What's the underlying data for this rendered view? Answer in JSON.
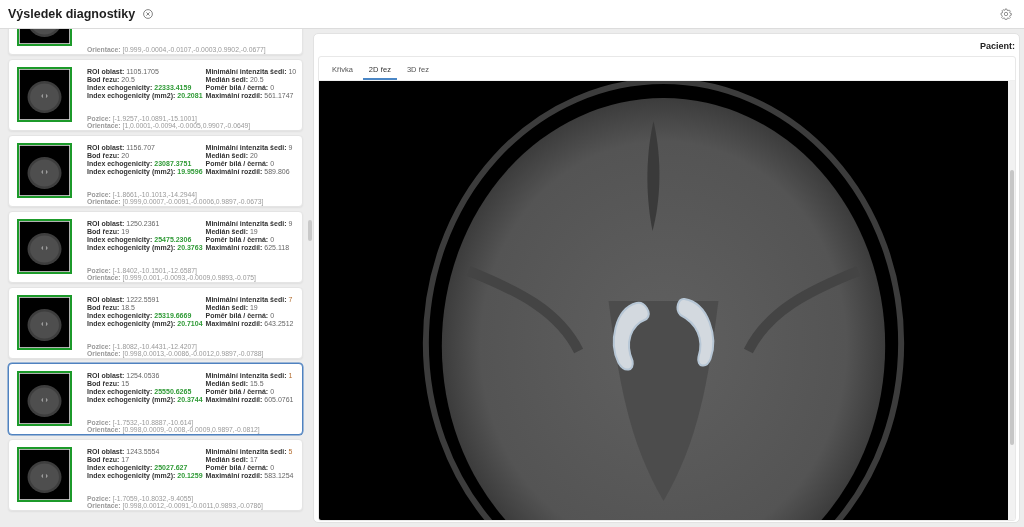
{
  "header": {
    "title": "Výsledek diagnostiky"
  },
  "results": [
    {
      "selected": false,
      "details": [
        {
          "label": "Orientace:",
          "value": "[0.999,-0.0004,-0.0107,-0.0003,0.9902,-0.0677]"
        }
      ]
    },
    {
      "selected": false,
      "left_fields": [
        {
          "label": "ROI oblast:",
          "value": "1105.1705",
          "kind": "plain"
        },
        {
          "label": "Bod řezu:",
          "value": "20.5",
          "kind": "plain"
        },
        {
          "label": "Index echogenicity:",
          "value": "22333.4159",
          "kind": "accent"
        },
        {
          "label": "Index echogenicity (mm2):",
          "value": "20.2081",
          "kind": "accent"
        }
      ],
      "right_fields": [
        {
          "label": "Minimální intenzita šedi:",
          "value": "10",
          "kind": "plain"
        },
        {
          "label": "Medián šedi:",
          "value": "20.5",
          "kind": "plain"
        },
        {
          "label": "Poměr bílá / černá:",
          "value": "0",
          "kind": "plain"
        },
        {
          "label": "Maximální rozdíl:",
          "value": "561.1747",
          "kind": "plain"
        }
      ],
      "details": [
        {
          "label": "Pozice:",
          "value": "[-1.9257,-10.0891,-15.1001]"
        },
        {
          "label": "Orientace:",
          "value": "[1,0.0001,-0.0094,-0.0005,0.9907,-0.0649]"
        }
      ]
    },
    {
      "selected": false,
      "left_fields": [
        {
          "label": "ROI oblast:",
          "value": "1156.707",
          "kind": "plain"
        },
        {
          "label": "Bod řezu:",
          "value": "20",
          "kind": "plain"
        },
        {
          "label": "Index echogenicity:",
          "value": "23087.3751",
          "kind": "accent"
        },
        {
          "label": "Index echogenicity (mm2):",
          "value": "19.9596",
          "kind": "accent"
        }
      ],
      "right_fields": [
        {
          "label": "Minimální intenzita šedi:",
          "value": "9",
          "kind": "plain"
        },
        {
          "label": "Medián šedi:",
          "value": "20",
          "kind": "plain"
        },
        {
          "label": "Poměr bílá / černá:",
          "value": "0",
          "kind": "plain"
        },
        {
          "label": "Maximální rozdíl:",
          "value": "589.806",
          "kind": "plain"
        }
      ],
      "details": [
        {
          "label": "Pozice:",
          "value": "[-1.8661,-10.1013,-14.2944]"
        },
        {
          "label": "Orientace:",
          "value": "[0.999,0.0007,-0.0091,-0.0006,0.9897,-0.0673]"
        }
      ]
    },
    {
      "selected": false,
      "left_fields": [
        {
          "label": "ROI oblast:",
          "value": "1250.2361",
          "kind": "plain"
        },
        {
          "label": "Bod řezu:",
          "value": "19",
          "kind": "plain"
        },
        {
          "label": "Index echogenicity:",
          "value": "25475.2306",
          "kind": "accent"
        },
        {
          "label": "Index echogenicity (mm2):",
          "value": "20.3763",
          "kind": "accent"
        }
      ],
      "right_fields": [
        {
          "label": "Minimální intenzita šedi:",
          "value": "9",
          "kind": "plain"
        },
        {
          "label": "Medián šedi:",
          "value": "19",
          "kind": "plain"
        },
        {
          "label": "Poměr bílá / černá:",
          "value": "0",
          "kind": "plain"
        },
        {
          "label": "Maximální rozdíl:",
          "value": "625.118",
          "kind": "plain"
        }
      ],
      "details": [
        {
          "label": "Pozice:",
          "value": "[-1.8402,-10.1501,-12.6587]"
        },
        {
          "label": "Orientace:",
          "value": "[0.999,0.001,-0.0093,-0.0009,0.9893,-0.075]"
        }
      ]
    },
    {
      "selected": false,
      "left_fields": [
        {
          "label": "ROI oblast:",
          "value": "1222.5591",
          "kind": "plain"
        },
        {
          "label": "Bod řezu:",
          "value": "18.5",
          "kind": "plain"
        },
        {
          "label": "Index echogenicity:",
          "value": "25319.6669",
          "kind": "accent"
        },
        {
          "label": "Index echogenicity (mm2):",
          "value": "20.7104",
          "kind": "accent"
        }
      ],
      "right_fields": [
        {
          "label": "Minimální intenzita šedi:",
          "value": "7",
          "kind": "warning"
        },
        {
          "label": "Medián šedi:",
          "value": "19",
          "kind": "plain"
        },
        {
          "label": "Poměr bílá / černá:",
          "value": "0",
          "kind": "plain"
        },
        {
          "label": "Maximální rozdíl:",
          "value": "643.2512",
          "kind": "plain"
        }
      ],
      "details": [
        {
          "label": "Pozice:",
          "value": "[-1.8082,-10.4431,-12.4207]"
        },
        {
          "label": "Orientace:",
          "value": "[0.998,0.0013,-0.0086,-0.0012,0.9897,-0.0788]"
        }
      ]
    },
    {
      "selected": true,
      "left_fields": [
        {
          "label": "ROI oblast:",
          "value": "1254.0536",
          "kind": "plain"
        },
        {
          "label": "Bod řezu:",
          "value": "15",
          "kind": "plain"
        },
        {
          "label": "Index echogenicity:",
          "value": "25550.6265",
          "kind": "accent"
        },
        {
          "label": "Index echogenicity (mm2):",
          "value": "20.3744",
          "kind": "accent"
        }
      ],
      "right_fields": [
        {
          "label": "Minimální intenzita šedi:",
          "value": "1",
          "kind": "warning"
        },
        {
          "label": "Medián šedi:",
          "value": "15.5",
          "kind": "plain"
        },
        {
          "label": "Poměr bílá / černá:",
          "value": "0",
          "kind": "plain"
        },
        {
          "label": "Maximální rozdíl:",
          "value": "605.0761",
          "kind": "plain"
        }
      ],
      "details": [
        {
          "label": "Pozice:",
          "value": "[-1.7532,-10.8887,-10.614]"
        },
        {
          "label": "Orientace:",
          "value": "[0.998,0.0009,-0.008,-0.0009,0.9897,-0.0812]"
        }
      ]
    },
    {
      "selected": false,
      "left_fields": [
        {
          "label": "ROI oblast:",
          "value": "1243.5554",
          "kind": "plain"
        },
        {
          "label": "Bod řezu:",
          "value": "17",
          "kind": "plain"
        },
        {
          "label": "Index echogenicity:",
          "value": "25027.627",
          "kind": "accent"
        },
        {
          "label": "Index echogenicity (mm2):",
          "value": "20.1259",
          "kind": "accent"
        }
      ],
      "right_fields": [
        {
          "label": "Minimální intenzita šedi:",
          "value": "5",
          "kind": "warning"
        },
        {
          "label": "Medián šedi:",
          "value": "17",
          "kind": "plain"
        },
        {
          "label": "Poměr bílá / černá:",
          "value": "0",
          "kind": "plain"
        },
        {
          "label": "Maximální rozdíl:",
          "value": "583.1254",
          "kind": "plain"
        }
      ],
      "details": [
        {
          "label": "Pozice:",
          "value": "[-1.7059,-10.8032,-9.4055]"
        },
        {
          "label": "Orientace:",
          "value": "[0.998,0.0012,-0.0091,-0.0011,0.9893,-0.0786]"
        }
      ]
    }
  ],
  "viewer": {
    "patient_label": "Pacient:",
    "tabs": [
      {
        "label": "Křivka",
        "selected": false
      },
      {
        "label": "2D řez",
        "selected": true
      },
      {
        "label": "3D řez",
        "selected": false
      }
    ]
  }
}
